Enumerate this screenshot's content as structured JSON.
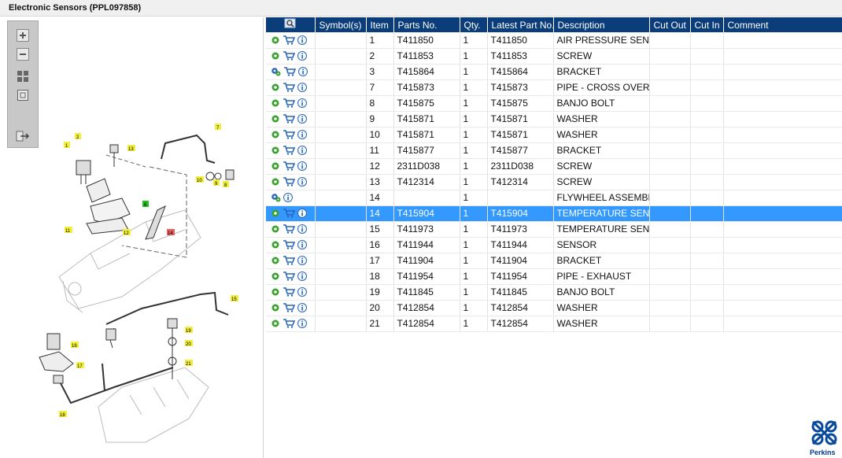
{
  "window": {
    "title": "Electronic Sensors (PPL097858)"
  },
  "toolbar": {
    "buttons": [
      {
        "name": "zoom-in-icon"
      },
      {
        "name": "zoom-out-icon"
      },
      {
        "name": "fit-grid-icon"
      },
      {
        "name": "actual-size-icon"
      },
      {
        "name": "export-icon"
      }
    ]
  },
  "diagram": {
    "callouts": [
      "1",
      "2",
      "3",
      "6",
      "7",
      "8",
      "9",
      "10",
      "11",
      "12",
      "13",
      "14",
      "15",
      "16",
      "17",
      "18",
      "19",
      "20",
      "21"
    ]
  },
  "table": {
    "headers": {
      "search": "",
      "symbols": "Symbol(s)",
      "item": "Item",
      "parts_no": "Parts No.",
      "qty": "Qty.",
      "latest_part_no": "Latest Part No.",
      "description": "Description",
      "cut_out": "Cut Out",
      "cut_in": "Cut In",
      "comment": "Comment"
    },
    "rows": [
      {
        "item": "1",
        "parts_no": "T411850",
        "qty": "1",
        "latest": "T411850",
        "desc": "AIR PRESSURE SENSOR",
        "icon": "gear",
        "cart": true
      },
      {
        "item": "2",
        "parts_no": "T411853",
        "qty": "1",
        "latest": "T411853",
        "desc": "SCREW",
        "icon": "gear",
        "cart": true
      },
      {
        "item": "3",
        "parts_no": "T415864",
        "qty": "1",
        "latest": "T415864",
        "desc": "BRACKET",
        "icon": "gears",
        "cart": true
      },
      {
        "item": "7",
        "parts_no": "T415873",
        "qty": "1",
        "latest": "T415873",
        "desc": "PIPE - CROSS OVER",
        "icon": "gear",
        "cart": true
      },
      {
        "item": "8",
        "parts_no": "T415875",
        "qty": "1",
        "latest": "T415875",
        "desc": "BANJO BOLT",
        "icon": "gear",
        "cart": true
      },
      {
        "item": "9",
        "parts_no": "T415871",
        "qty": "1",
        "latest": "T415871",
        "desc": "WASHER",
        "icon": "gear",
        "cart": true
      },
      {
        "item": "10",
        "parts_no": "T415871",
        "qty": "1",
        "latest": "T415871",
        "desc": "WASHER",
        "icon": "gear",
        "cart": true
      },
      {
        "item": "11",
        "parts_no": "T415877",
        "qty": "1",
        "latest": "T415877",
        "desc": "BRACKET",
        "icon": "gear",
        "cart": true
      },
      {
        "item": "12",
        "parts_no": "2311D038",
        "qty": "1",
        "latest": "2311D038",
        "desc": "SCREW",
        "icon": "gear",
        "cart": true
      },
      {
        "item": "13",
        "parts_no": "T412314",
        "qty": "1",
        "latest": "T412314",
        "desc": "SCREW",
        "icon": "gear",
        "cart": true
      },
      {
        "item": "14",
        "parts_no": "",
        "qty": "1",
        "latest": "",
        "desc": "FLYWHEEL ASSEMBLY",
        "icon": "gears",
        "cart": false
      },
      {
        "item": "14",
        "parts_no": "T415904",
        "qty": "1",
        "latest": "T415904",
        "desc": "TEMPERATURE SENSOR",
        "icon": "gear",
        "cart": true,
        "selected": true
      },
      {
        "item": "15",
        "parts_no": "T411973",
        "qty": "1",
        "latest": "T411973",
        "desc": "TEMPERATURE SENSOR",
        "icon": "gear",
        "cart": true
      },
      {
        "item": "16",
        "parts_no": "T411944",
        "qty": "1",
        "latest": "T411944",
        "desc": "SENSOR",
        "icon": "gear",
        "cart": true
      },
      {
        "item": "17",
        "parts_no": "T411904",
        "qty": "1",
        "latest": "T411904",
        "desc": "BRACKET",
        "icon": "gear",
        "cart": true
      },
      {
        "item": "18",
        "parts_no": "T411954",
        "qty": "1",
        "latest": "T411954",
        "desc": "PIPE - EXHAUST",
        "icon": "gear",
        "cart": true
      },
      {
        "item": "19",
        "parts_no": "T411845",
        "qty": "1",
        "latest": "T411845",
        "desc": "BANJO BOLT",
        "icon": "gear",
        "cart": true
      },
      {
        "item": "20",
        "parts_no": "T412854",
        "qty": "1",
        "latest": "T412854",
        "desc": "WASHER",
        "icon": "gear",
        "cart": true
      },
      {
        "item": "21",
        "parts_no": "T412854",
        "qty": "1",
        "latest": "T412854",
        "desc": "WASHER",
        "icon": "gear",
        "cart": true
      }
    ]
  },
  "branding": {
    "logo_text": "Perkins"
  },
  "colors": {
    "header_bg": "#0a3d7a",
    "selected_row": "#3399ff",
    "gear_green": "#3aa030",
    "cart_blue": "#2a66b8",
    "callout_yellow": "#f2ef3a"
  }
}
